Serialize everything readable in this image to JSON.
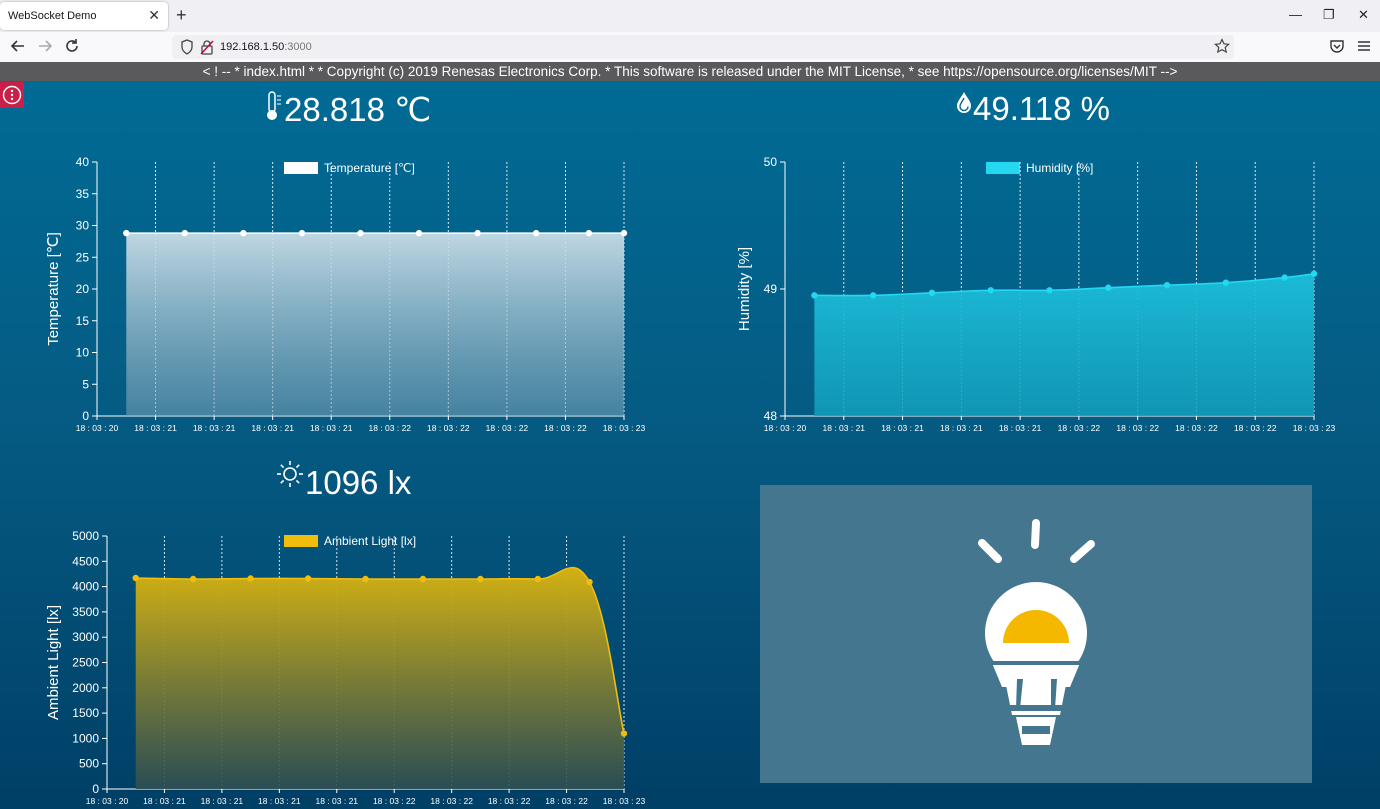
{
  "browser": {
    "tab_title": "WebSocket Demo",
    "tab_close": "✕",
    "new_tab": "+",
    "url_host": "192.168.1.50",
    "url_port": ":3000",
    "win_minimize": "—",
    "win_restore": "❐",
    "win_close": "✕"
  },
  "banner": "< ! -- * index.html * * Copyright (c) 2019 Renesas Electronics Corp. * This software is released under the MIT License, * see https://opensource.org/licenses/MIT -->",
  "readouts": {
    "temperature": "28.818 ℃",
    "humidity": "49.118 %",
    "light": "1096 lx"
  },
  "colors": {
    "temperature": "#ffffff",
    "humidity": "#23d8f0",
    "light": "#f1bd0d",
    "bulb": "#f5b800"
  },
  "chart_data": [
    {
      "type": "area",
      "legend": "Temperature [℃]",
      "ylabel": "Temperature [℃]",
      "ylim": [
        0,
        40
      ],
      "yticks": [
        0,
        5,
        10,
        15,
        20,
        25,
        30,
        35,
        40
      ],
      "xticks": [
        "18 : 03 : 20",
        "18 : 03 : 21",
        "18 : 03 : 21",
        "18 : 03 : 21",
        "18 : 03 : 21",
        "18 : 03 : 22",
        "18 : 03 : 22",
        "18 : 03 : 22",
        "18 : 03 : 22",
        "18 : 03 : 23"
      ],
      "x": [
        0.5,
        1.5,
        2.5,
        3.5,
        4.5,
        5.5,
        6.5,
        7.5,
        8.4,
        9
      ],
      "values": [
        28.8,
        28.8,
        28.8,
        28.8,
        28.8,
        28.8,
        28.8,
        28.8,
        28.8,
        28.8
      ]
    },
    {
      "type": "area",
      "legend": "Humidity [%]",
      "ylabel": "Humidity [%]",
      "ylim": [
        48,
        50
      ],
      "yticks": [
        48,
        49,
        50
      ],
      "xticks": [
        "18 : 03 : 20",
        "18 : 03 : 21",
        "18 : 03 : 21",
        "18 : 03 : 21",
        "18 : 03 : 21",
        "18 : 03 : 22",
        "18 : 03 : 22",
        "18 : 03 : 22",
        "18 : 03 : 22",
        "18 : 03 : 23"
      ],
      "x": [
        0.5,
        1.5,
        2.5,
        3.5,
        4.5,
        5.5,
        6.5,
        7.5,
        8.5,
        9
      ],
      "values": [
        48.95,
        48.95,
        48.97,
        48.99,
        48.99,
        49.01,
        49.03,
        49.05,
        49.09,
        49.12
      ]
    },
    {
      "type": "area",
      "legend": "Ambient Light [lx]",
      "ylabel": "Ambient Light [lx]",
      "ylim": [
        0,
        5000
      ],
      "yticks": [
        0,
        500,
        1000,
        1500,
        2000,
        2500,
        3000,
        3500,
        4000,
        4500,
        5000
      ],
      "xticks": [
        "18 : 03 : 20",
        "18 : 03 : 21",
        "18 : 03 : 21",
        "18 : 03 : 21",
        "18 : 03 : 21",
        "18 : 03 : 22",
        "18 : 03 : 22",
        "18 : 03 : 22",
        "18 : 03 : 22",
        "18 : 03 : 23"
      ],
      "x": [
        0.5,
        1.5,
        2.5,
        3.5,
        4.5,
        5.5,
        6.5,
        7.5,
        8.4,
        9
      ],
      "values": [
        4170,
        4150,
        4160,
        4160,
        4150,
        4150,
        4150,
        4150,
        4090,
        1096
      ]
    }
  ]
}
